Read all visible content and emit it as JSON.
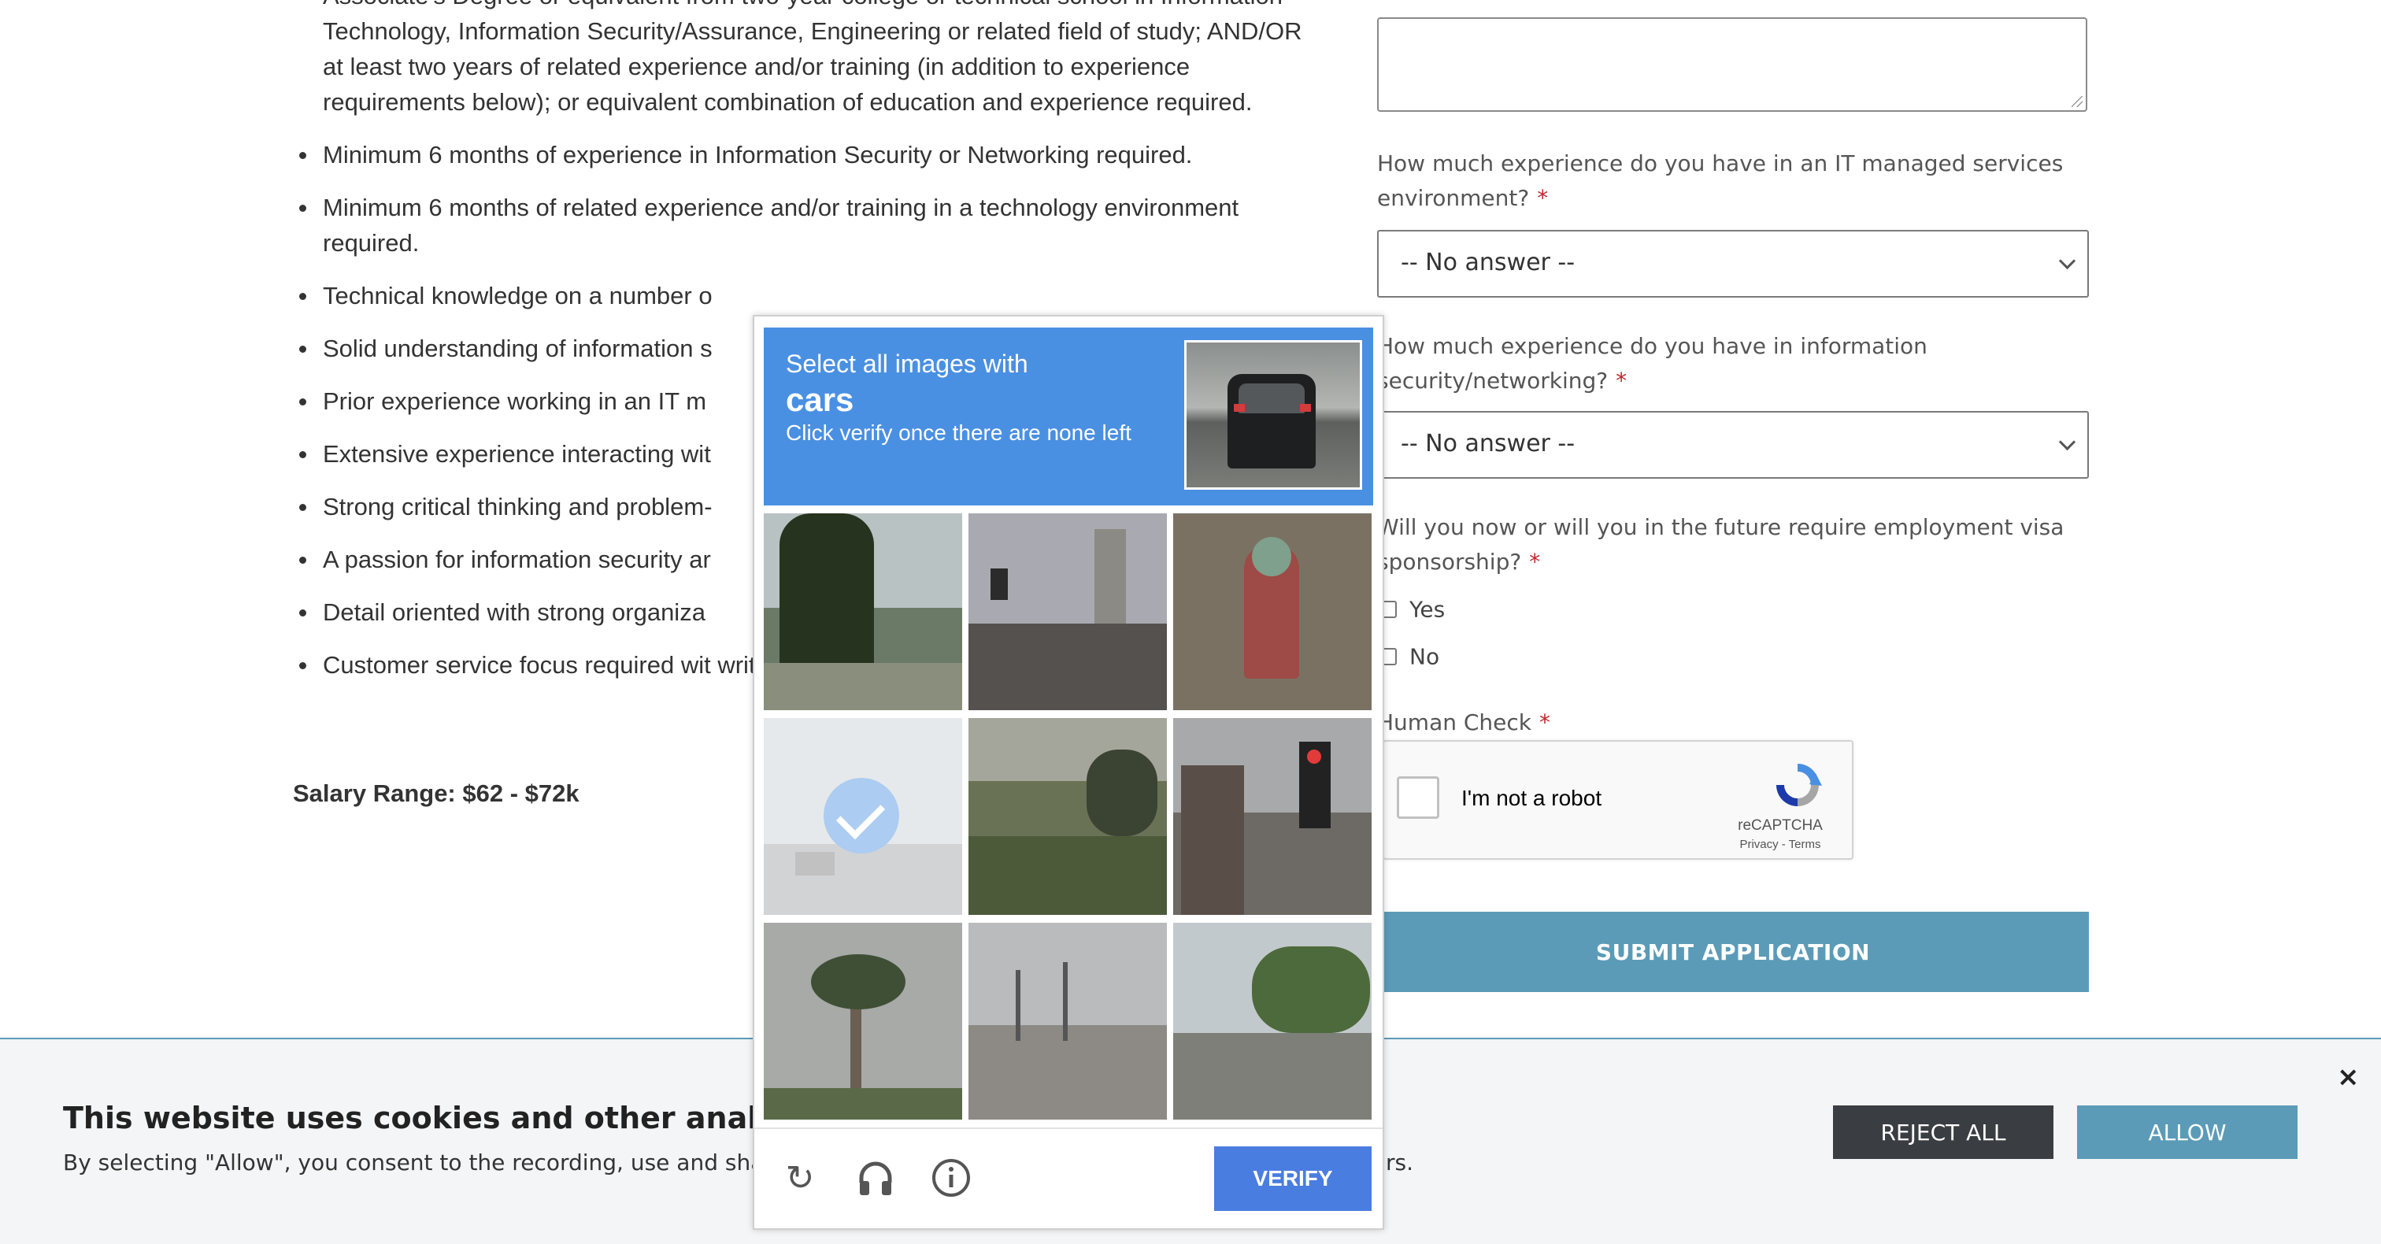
{
  "job": {
    "bullets": [
      "Associate's Degree or equivalent from two-year college or technical school in Information Technology, Information Security/Assurance, Engineering or related field of study; AND/OR at least two years of related experience and/or training (in addition to experience requirements below); or equivalent combination of education and experience required.",
      "Minimum 6 months of experience in Information Security or Networking required.",
      "Minimum 6 months of related experience and/or training in a technology environment required.",
      "Technical knowledge on a number o",
      "Solid understanding of information s",
      "Prior experience working in an IT m",
      "Extensive experience interacting wit",
      "Strong critical thinking and problem-",
      "A passion for information security ar",
      "Detail oriented with strong organiza",
      "Customer service focus required wit written/verbal communication skills."
    ],
    "salary_label": "Salary Range: $62 - $72k"
  },
  "form": {
    "partial_question": "... ... ...",
    "q_managed_services": "How much experience do you have in an IT managed services environment?",
    "q_security": "How much experience do you have in information security/networking?",
    "q_visa": "Will you now or will you in the future require employment visa sponsorship?",
    "select_value": "-- No answer --",
    "required_mark": "*",
    "visa_yes": "Yes",
    "visa_no": "No",
    "human_check_label": "Human Check",
    "recaptcha_label": "I'm not a robot",
    "recaptcha_brand": "reCAPTCHA",
    "recaptcha_terms": "Privacy - Terms",
    "submit_label": "SUBMIT APPLICATION"
  },
  "captcha": {
    "instruction": "Select all images with",
    "target": "cars",
    "hint": "Click verify once there are none left",
    "verify_label": "VERIFY",
    "selected_tiles": [
      3
    ],
    "icons": [
      "refresh-icon",
      "headphones-icon",
      "info-icon"
    ],
    "accent_color": "#4a90e2"
  },
  "cookie": {
    "title": "This website uses cookies and other analytics techn",
    "body": "By selecting \"Allow\", you consent to the recording, use and sharing",
    "body_end": "rs.",
    "reject_label": "REJECT ALL",
    "allow_label": "ALLOW",
    "close_glyph": "×"
  },
  "colors": {
    "primary": "#5b9bb7",
    "dark_button": "#3a3d42",
    "required": "#c0262d"
  }
}
